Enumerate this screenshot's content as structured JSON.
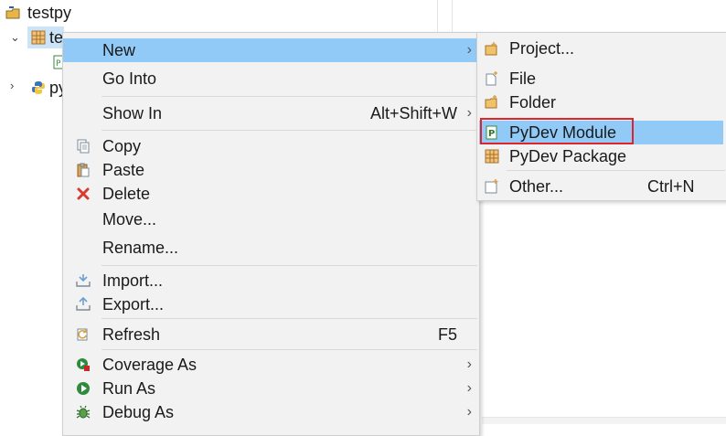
{
  "tree": {
    "project_label": "testpy",
    "folder_label_partial": "te",
    "second_item_label_partial": "py"
  },
  "context_menu": {
    "items": [
      {
        "label": "New",
        "icon": "none",
        "has_submenu": true
      },
      {
        "label": "Go Into",
        "icon": "none"
      },
      {
        "label": "Show In",
        "shortcut": "Alt+Shift+W",
        "has_submenu": true
      },
      {
        "label": "Copy",
        "icon": "copy-icon"
      },
      {
        "label": "Paste",
        "icon": "paste-icon"
      },
      {
        "label": "Delete",
        "icon": "delete-icon",
        "icon_color": "#d63b2f"
      },
      {
        "label": "Move...",
        "icon": "none"
      },
      {
        "label": "Rename...",
        "icon": "none"
      },
      {
        "label": "Import...",
        "icon": "import-icon"
      },
      {
        "label": "Export...",
        "icon": "export-icon"
      },
      {
        "label": "Refresh",
        "shortcut": "F5",
        "icon": "refresh-icon"
      },
      {
        "label": "Coverage As",
        "icon": "coverage-icon",
        "has_submenu": true
      },
      {
        "label": "Run As",
        "icon": "run-icon",
        "has_submenu": true
      },
      {
        "label": "Debug As",
        "icon": "debug-icon",
        "has_submenu": true
      }
    ],
    "highlight_color": "#91c9f7"
  },
  "submenu": {
    "items": [
      {
        "label": "Project...",
        "icon": "project-icon"
      },
      {
        "label": "File",
        "icon": "file-icon"
      },
      {
        "label": "Folder",
        "icon": "folder-icon"
      },
      {
        "label": "PyDev Module",
        "icon": "pydev-module-icon",
        "highlighted": true
      },
      {
        "label": "PyDev Package",
        "icon": "pydev-package-icon"
      },
      {
        "label": "Other...",
        "shortcut": "Ctrl+N",
        "icon": "other-icon"
      }
    ],
    "callout_color": "#e0242b"
  }
}
